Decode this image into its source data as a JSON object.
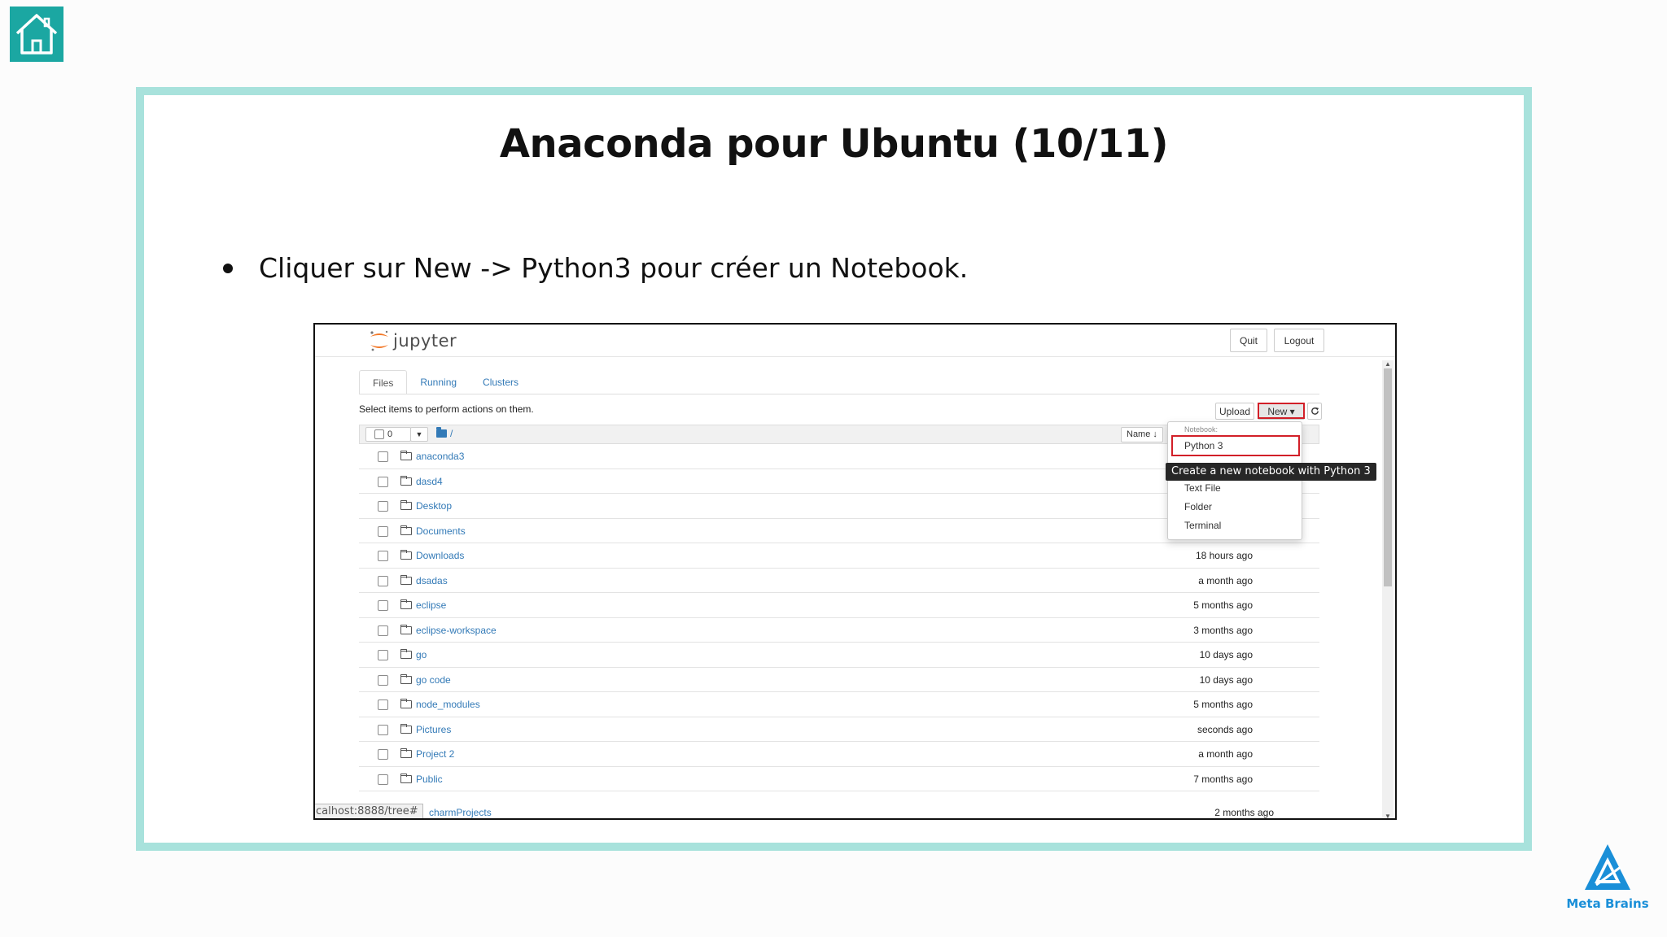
{
  "slide": {
    "title": "Anaconda pour Ubuntu (10/11)",
    "bullet": "Cliquer sur New -> Python3 pour créer un Notebook.",
    "brand": "Meta Brains",
    "colors": {
      "accent": "#1ba7a2",
      "frame": "#a8e2dc",
      "highlight": "#d21f28",
      "brand": "#1a8fd8"
    }
  },
  "jupyter": {
    "logo_text": "jupyter",
    "header_buttons": {
      "quit": "Quit",
      "logout": "Logout"
    },
    "tabs": [
      {
        "label": "Files",
        "active": true
      },
      {
        "label": "Running",
        "active": false
      },
      {
        "label": "Clusters",
        "active": false
      }
    ],
    "select_message": "Select items to perform actions on them.",
    "toolbar": {
      "upload": "Upload",
      "new": "New ▾",
      "refresh_icon": "refresh-icon"
    },
    "list_header": {
      "selected_count": "0",
      "breadcrumb": "/",
      "name_sort": "Name ↓",
      "right_sort": "e"
    },
    "dropdown": {
      "section_header": "Notebook:",
      "python3": "Python 3",
      "tooltip": "Create a new notebook with Python 3",
      "text_file": "Text File",
      "folder": "Folder",
      "terminal": "Terminal"
    },
    "rows": [
      {
        "name": "anaconda3",
        "time": ""
      },
      {
        "name": "dasd4",
        "time": ""
      },
      {
        "name": "Desktop",
        "time": ""
      },
      {
        "name": "Documents",
        "time": ""
      },
      {
        "name": "Downloads",
        "time": "18 hours ago"
      },
      {
        "name": "dsadas",
        "time": "a month ago"
      },
      {
        "name": "eclipse",
        "time": "5 months ago"
      },
      {
        "name": "eclipse-workspace",
        "time": "3 months ago"
      },
      {
        "name": "go",
        "time": "10 days ago"
      },
      {
        "name": "go code",
        "time": "10 days ago"
      },
      {
        "name": "node_modules",
        "time": "5 months ago"
      },
      {
        "name": "Pictures",
        "time": "seconds ago"
      },
      {
        "name": "Project 2",
        "time": "a month ago"
      },
      {
        "name": "Public",
        "time": "7 months ago"
      }
    ],
    "status_url": "calhost:8888/tree#",
    "last_row": {
      "name": "charmProjects",
      "time": "2 months ago"
    }
  }
}
